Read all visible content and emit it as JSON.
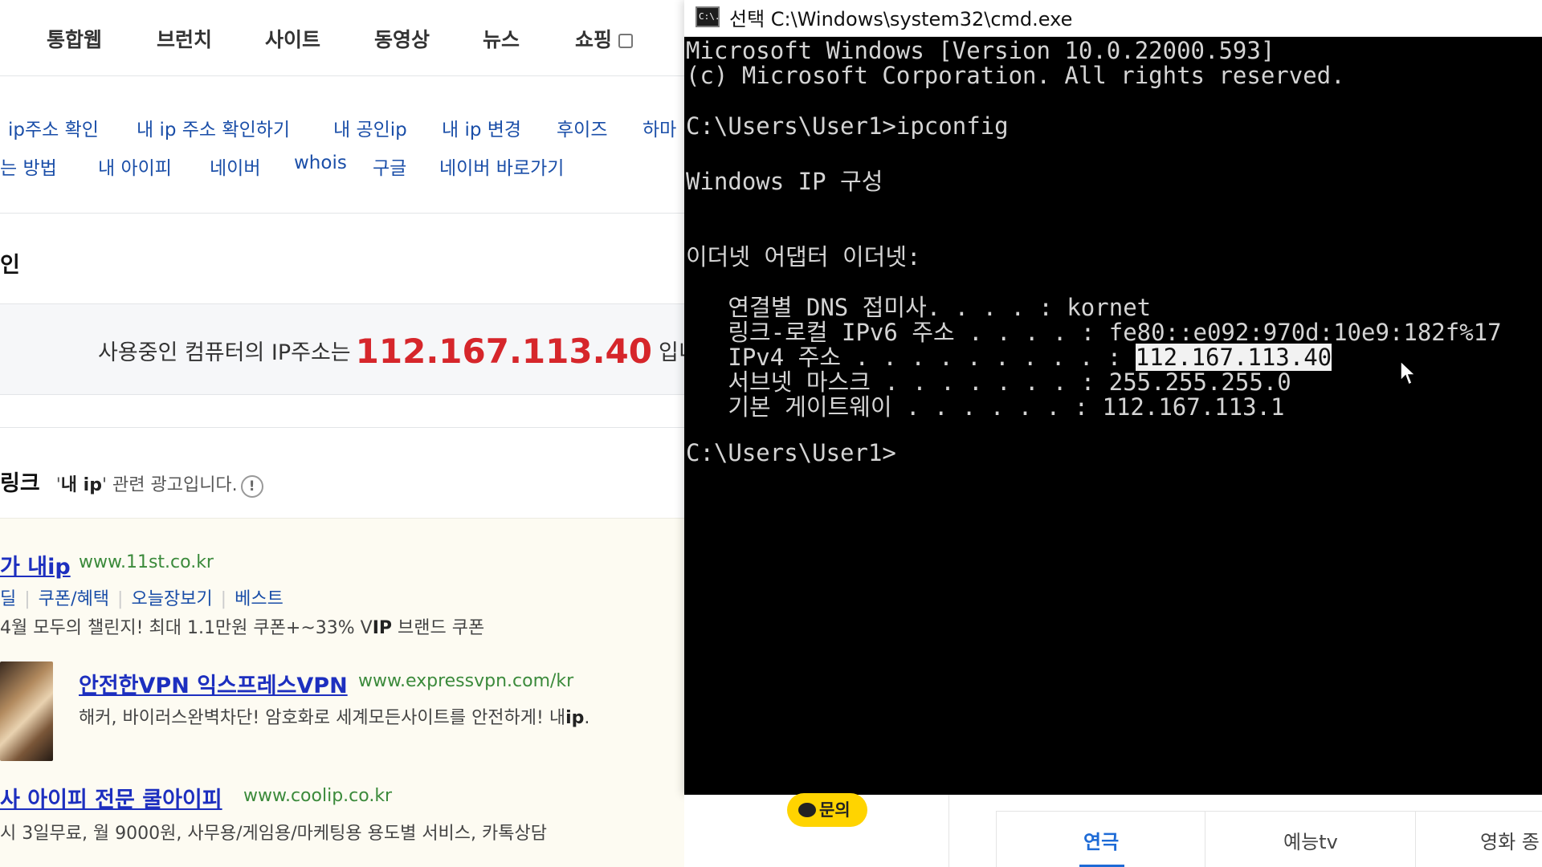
{
  "browser": {
    "tabs": [
      "통합웹",
      "브런치",
      "사이트",
      "동영상",
      "뉴스",
      "쇼핑"
    ],
    "related_row1": [
      "ip주소 확인",
      "내 ip 주소 확인하기",
      "내 공인ip",
      "내 ip 변경",
      "후이즈",
      "하마"
    ],
    "related_row2": [
      "는 방법",
      "내 아이피",
      "네이버",
      "whois",
      "구글",
      "네이버 바로가기"
    ],
    "ip_section_title": "인",
    "ip_prefix": "사용중인 컴퓨터의 IP주소는",
    "ip_value": "112.167.113.40",
    "ip_suffix": "입니",
    "ad_heading": "링크",
    "ad_note_open": "'",
    "ad_note_keyword": "내 ip",
    "ad_note_close": "' 관련 광고입니다.",
    "ad_note_icon": "!",
    "ads": [
      {
        "title": "가 내ip",
        "url": "www.11st.co.kr",
        "links": [
          "딜",
          "쿠폰/혜택",
          "오늘장보기",
          "베스트"
        ],
        "desc_pre": "4월 모두의 챌린지! 최대 1.1만원 쿠폰+~33% V",
        "desc_bold": "IP",
        "desc_post": " 브랜드 쿠폰"
      },
      {
        "title": "안전한VPN 익스프레스VPN",
        "url": "www.expressvpn.com/kr",
        "desc_pre": "해커, 바이러스완벽차단! 암호화로 세계모든사이트를 안전하게! 내",
        "desc_bold": "ip",
        "desc_post": "."
      },
      {
        "title": "사 아이피 전문 쿨아이피",
        "url": "www.coolip.co.kr",
        "desc": "시 3일무료, 월 9000원, 사무용/게임용/마케팅용 용도별 서비스, 카톡상담"
      }
    ]
  },
  "cmd": {
    "icon_text": "C:\\.",
    "title": "선택 C:\\Windows\\system32\\cmd.exe",
    "lines": [
      "Microsoft Windows [Version 10.0.22000.593]",
      "(c) Microsoft Corporation. All rights reserved.",
      "C:\\Users\\User1>ipconfig",
      "Windows IP 구성",
      "이더넷 어댑터 이더넷:",
      "   연결별 DNS 접미사. . . . : kornet",
      "   링크-로컬 IPv6 주소 . . . . : fe80::e092:970d:10e9:182f%17",
      "   IPv4 주소 . . . . . . . . . : ",
      "112.167.113.40",
      "   서브넷 마스크 . . . . . . . : 255.255.255.0",
      "   기본 게이트웨이 . . . . . . : 112.167.113.1",
      "C:\\Users\\User1>"
    ]
  },
  "bottom": {
    "chat_label": "문의",
    "category_tabs": [
      "연극",
      "예능tv",
      "영화 종"
    ]
  },
  "colors": {
    "ip_highlight": "#d6262b",
    "link_blue": "#1a4ea8",
    "ad_title_blue": "#1d2fbf",
    "url_green": "#3b8a3b",
    "active_tab": "#1e6bd6",
    "chat_yellow": "#ffd400"
  },
  "icons": [
    "cmd-app-icon",
    "checkbox-icon",
    "info-icon",
    "chat-bubble-icon",
    "mouse-pointer-icon"
  ]
}
